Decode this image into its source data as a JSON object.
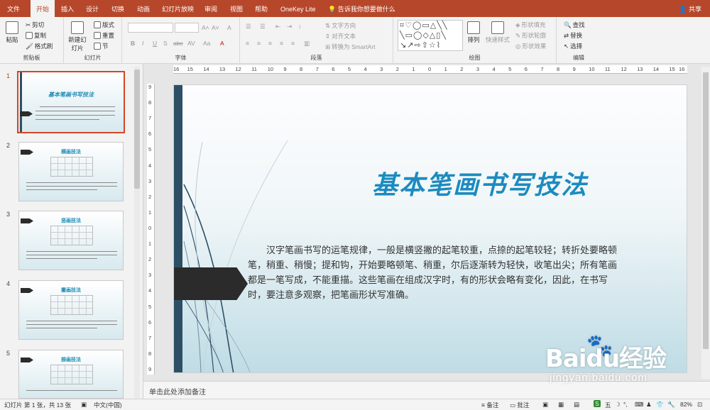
{
  "menu": {
    "tabs": [
      "文件",
      "开始",
      "插入",
      "设计",
      "切换",
      "动画",
      "幻灯片放映",
      "审阅",
      "视图",
      "帮助",
      "OneKey Lite"
    ],
    "active": "开始",
    "tell_me": "告诉我你想要做什么",
    "share": "共享"
  },
  "ribbon": {
    "clipboard": {
      "label": "剪贴板",
      "paste": "粘贴",
      "cut": "剪切",
      "copy": "复制",
      "format_painter": "格式刷"
    },
    "slides": {
      "label": "幻灯片",
      "new_slide": "新建幻灯片",
      "layout": "版式",
      "reset": "重置",
      "section": "节"
    },
    "font": {
      "label": "字体",
      "bold": "B",
      "italic": "I",
      "underline": "U",
      "shadow": "S",
      "strike": "abc",
      "spacing": "AV",
      "case": "Aa",
      "grow": "A˄",
      "shrink": "A˅",
      "clear": "A",
      "color": "A"
    },
    "paragraph": {
      "label": "段落",
      "text_direction": "文字方向",
      "align_text": "对齐文本",
      "smartart": "转换为 SmartArt"
    },
    "drawing": {
      "label": "绘图",
      "arrange": "排列",
      "quick_styles": "快速样式",
      "fill": "形状填充",
      "outline": "形状轮廓",
      "effects": "形状效果"
    },
    "editing": {
      "label": "编辑",
      "find": "查找",
      "replace": "替换",
      "select": "选择"
    }
  },
  "ruler": {
    "h": [
      "16",
      "15",
      "14",
      "13",
      "12",
      "11",
      "10",
      "9",
      "8",
      "7",
      "6",
      "5",
      "4",
      "3",
      "2",
      "1",
      "0",
      "1",
      "2",
      "3",
      "4",
      "5",
      "6",
      "7",
      "8",
      "9",
      "10",
      "11",
      "12",
      "13",
      "14",
      "15",
      "16"
    ],
    "v": [
      "9",
      "8",
      "7",
      "6",
      "5",
      "4",
      "3",
      "2",
      "1",
      "0",
      "1",
      "2",
      "3",
      "4",
      "5",
      "6",
      "7",
      "8",
      "9"
    ]
  },
  "thumbnails": [
    {
      "num": "1",
      "title": "基本笔画书写技法"
    },
    {
      "num": "2",
      "title": "横画技法"
    },
    {
      "num": "3",
      "title": "竖画技法"
    },
    {
      "num": "4",
      "title": "撇画技法"
    },
    {
      "num": "5",
      "title": "捺画技法"
    }
  ],
  "slide": {
    "title": "基本笔画书写技法",
    "body": "汉字笔画书写的运笔规律，一般是横竖撇的起笔较重，点捺的起笔较轻；转折处要略顿笔，稍重、稍慢；提和钩，开始要略顿笔、稍重，尔后逐渐转为轻快，收笔出尖；所有笔画都是一笔写成，不能重描。这些笔画在组成汉字时，有的形状会略有变化，因此，在书写时，要注意多观察，把笔画形状写准确。",
    "colors": {
      "title": "#1c8bbf",
      "bar": "#2d4f66",
      "arrow": "#2b2b2b"
    }
  },
  "notes": {
    "placeholder": "单击此处添加备注"
  },
  "status": {
    "slide_info": "幻灯片 第 1 张，共 13 张",
    "language": "中文(中国)",
    "notes_btn": "备注",
    "comments_btn": "批注",
    "zoom": "82%",
    "ime": "五"
  },
  "watermark": {
    "logo": "Baidu经验",
    "url": "jingyan.baidu.com"
  }
}
